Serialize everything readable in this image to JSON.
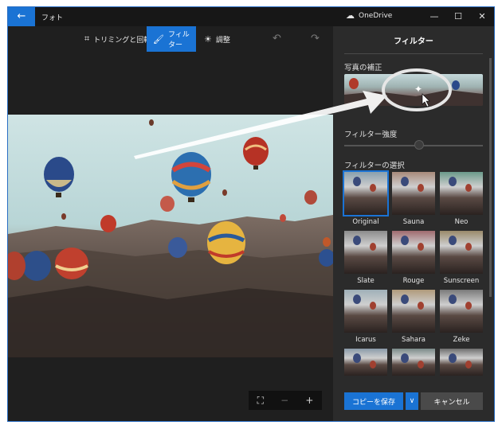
{
  "window": {
    "title": "フォト",
    "back_icon": "arrow-left-icon"
  },
  "titlebar": {
    "onedrive_label": "OneDrive",
    "minimize": "—",
    "maximize": "☐",
    "close": "✕"
  },
  "toolbar": {
    "crop_label": "トリミングと回転",
    "filter_label": "フィルター",
    "adjust_label": "調整",
    "undo_icon": "↶",
    "redo_icon": "↷"
  },
  "panel": {
    "title": "フィルター",
    "enhance_label": "写真の補正",
    "strength_label": "フィルター強度",
    "choose_label": "フィルターの選択",
    "filters": [
      {
        "name": "Original",
        "selected": true,
        "tint": "#8aa0ad"
      },
      {
        "name": "Sauna",
        "selected": false,
        "tint": "#a88a7a"
      },
      {
        "name": "Neo",
        "selected": false,
        "tint": "#6a9a8a"
      },
      {
        "name": "Slate",
        "selected": false,
        "tint": "#8c8c8c"
      },
      {
        "name": "Rouge",
        "selected": false,
        "tint": "#a06a6e"
      },
      {
        "name": "Sunscreen",
        "selected": false,
        "tint": "#9a8a6a"
      },
      {
        "name": "Icarus",
        "selected": false,
        "tint": "#9fb0b8"
      },
      {
        "name": "Sahara",
        "selected": false,
        "tint": "#b09a7a"
      },
      {
        "name": "Zeke",
        "selected": false,
        "tint": "#7a7a7a"
      },
      {
        "name": "",
        "selected": false,
        "tint": "#8a9aa8"
      },
      {
        "name": "",
        "selected": false,
        "tint": "#7a8a88"
      },
      {
        "name": "",
        "selected": false,
        "tint": "#6e6e6e"
      }
    ],
    "save_label": "コピーを保存",
    "save_dropdown_icon": "∨",
    "cancel_label": "キャンセル"
  },
  "zoom": {
    "fit_icon": "⛶",
    "zoom_out": "−",
    "zoom_in": "+"
  },
  "colors": {
    "accent": "#1a73d4",
    "panel_bg": "#2b2b2b",
    "app_bg": "#1f1f1f"
  }
}
